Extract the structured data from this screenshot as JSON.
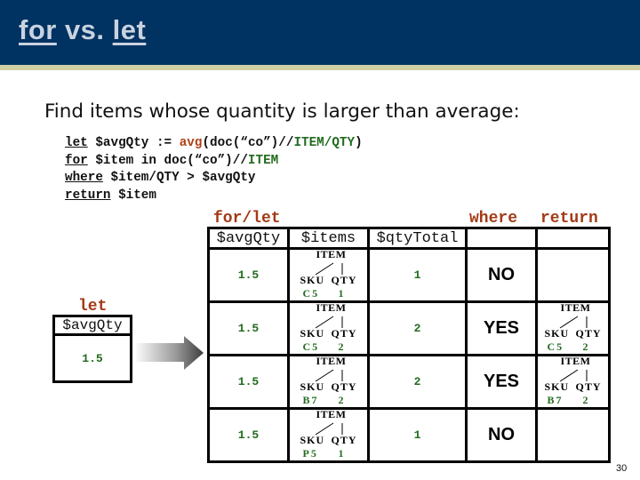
{
  "header": {
    "title_for": "for",
    "title_vs": " vs. ",
    "title_let": "let",
    "colors": {
      "band": "#003262",
      "stripe": "#cfcfa3",
      "title_text": "#c9d3df"
    }
  },
  "subtitle": "Find items whose quantity is larger than average:",
  "code": {
    "line1": {
      "kw": "let",
      "a": " $avgQty := ",
      "fn": "avg",
      "b": "(doc(“co”)//",
      "path": "ITEM/QTY",
      "c": ")"
    },
    "line2": {
      "kw": "for",
      "a": " $item in doc(“co”)//",
      "path": "ITEM"
    },
    "line3": {
      "kw": "where",
      "a": " $item/QTY > $avgQty"
    },
    "line4": {
      "kw": "return",
      "a": " $item"
    }
  },
  "labels": {
    "for_let": "for/let",
    "where": "where",
    "return": "return",
    "let": "let"
  },
  "let_box": {
    "header": "$avgQty",
    "value": "1.5"
  },
  "table": {
    "headers": [
      "$avgQty",
      "$items",
      "$qtyTotal",
      "",
      ""
    ],
    "rows": [
      {
        "avgQty": "1.5",
        "item": {
          "tag": "ITEM",
          "sku_label": "SKU",
          "qty_label": "QTY",
          "sku": "C5",
          "qty": "1"
        },
        "qtyTotal": "1",
        "where": "NO",
        "return": null
      },
      {
        "avgQty": "1.5",
        "item": {
          "tag": "ITEM",
          "sku_label": "SKU",
          "qty_label": "QTY",
          "sku": "C5",
          "qty": "2"
        },
        "qtyTotal": "2",
        "where": "YES",
        "return": {
          "tag": "ITEM",
          "sku_label": "SKU",
          "qty_label": "QTY",
          "sku": "C5",
          "qty": "2"
        }
      },
      {
        "avgQty": "1.5",
        "item": {
          "tag": "ITEM",
          "sku_label": "SKU",
          "qty_label": "QTY",
          "sku": "B7",
          "qty": "2"
        },
        "qtyTotal": "2",
        "where": "YES",
        "return": {
          "tag": "ITEM",
          "sku_label": "SKU",
          "qty_label": "QTY",
          "sku": "B7",
          "qty": "2"
        }
      },
      {
        "avgQty": "1.5",
        "item": {
          "tag": "ITEM",
          "sku_label": "SKU",
          "qty_label": "QTY",
          "sku": "P5",
          "qty": "1"
        },
        "qtyTotal": "1",
        "where": "NO",
        "return": null
      }
    ]
  },
  "page_number": "30",
  "colors": {
    "keyword_brown": "#a33a15",
    "function": "#b2401a",
    "path_green": "#226b1f",
    "value_green": "#226b1f"
  }
}
